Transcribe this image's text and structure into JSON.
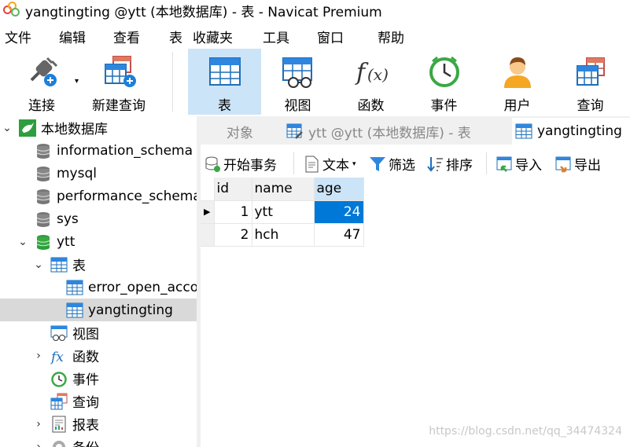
{
  "window": {
    "title": "yangtingting @ytt (本地数据库) - 表 - Navicat Premium"
  },
  "menu": [
    "文件",
    "编辑",
    "查看",
    "表",
    "收藏夹",
    "工具",
    "窗口",
    "帮助"
  ],
  "toolbar": {
    "connect": "连接",
    "new_query": "新建查询",
    "table": "表",
    "view": "视图",
    "function": "函数",
    "event": "事件",
    "user": "用户",
    "query": "查询"
  },
  "tree": {
    "root": "本地数据库",
    "databases": [
      "information_schema",
      "mysql",
      "performance_schema",
      "sys",
      "ytt"
    ],
    "ytt_children": {
      "tables_label": "表",
      "tables": [
        "error_open_acco",
        "yangtingting"
      ],
      "views": "视图",
      "functions": "函数",
      "events": "事件",
      "queries": "查询",
      "reports": "报表",
      "backup": "备份"
    }
  },
  "tabs": {
    "objects": "对象",
    "tab1": "ytt @ytt (本地数据库) - 表",
    "tab2": "yangtingting"
  },
  "subtoolbar": {
    "begin_transaction": "开始事务",
    "text": "文本",
    "filter": "筛选",
    "sort": "排序",
    "import": "导入",
    "export": "导出"
  },
  "grid": {
    "columns": [
      "id",
      "name",
      "age"
    ],
    "rows": [
      {
        "id": "1",
        "name": "ytt",
        "age": "24"
      },
      {
        "id": "2",
        "name": "hch",
        "age": "47"
      }
    ]
  },
  "watermark": "https://blog.csdn.net/qq_34474324",
  "colors": {
    "accent": "#0078d7",
    "selection": "#cce4f7",
    "db_green": "#2e9e3e"
  }
}
